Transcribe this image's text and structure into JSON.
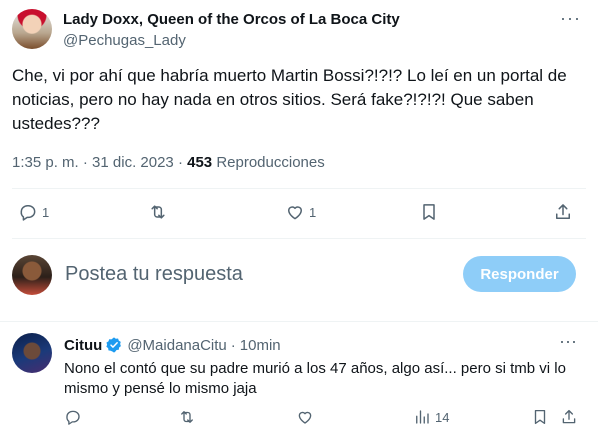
{
  "tweet": {
    "author_name": "Lady Doxx, Queen of the Orcos of La Boca City",
    "author_handle": "@Pechugas_Lady",
    "text": "Che, vi por ahí que habría muerto Martin Bossi?!?!? Lo leí en un portal de noticias, pero no hay nada en otros sitios. Será fake?!?!?! Que saben ustedes???",
    "time": "1:35 p. m.",
    "date": "31 dic. 2023",
    "views_count": "453",
    "views_label": "Reproducciones",
    "more_glyph": "···",
    "actions": {
      "replies": "1",
      "retweets": "",
      "likes": "1"
    }
  },
  "compose": {
    "placeholder": "Postea tu respuesta",
    "button_label": "Responder",
    "button_color": "#8ecdf8"
  },
  "reply": {
    "name": "Cituu",
    "handle": "@MaidanaCitu",
    "separator": "·",
    "time": "10min",
    "text": "Nono el contó que su padre murió a los 47 años, algo así... pero si tmb vi lo mismo y pensé lo mismo jaja",
    "views": "14",
    "verified_color": "#1d9bf0",
    "more_glyph": "···"
  },
  "icons": {
    "reply": "reply-icon",
    "retweet": "retweet-icon",
    "like": "heart-icon",
    "bookmark": "bookmark-icon",
    "share": "share-icon",
    "views": "views-icon",
    "verified": "verified-badge-icon"
  }
}
